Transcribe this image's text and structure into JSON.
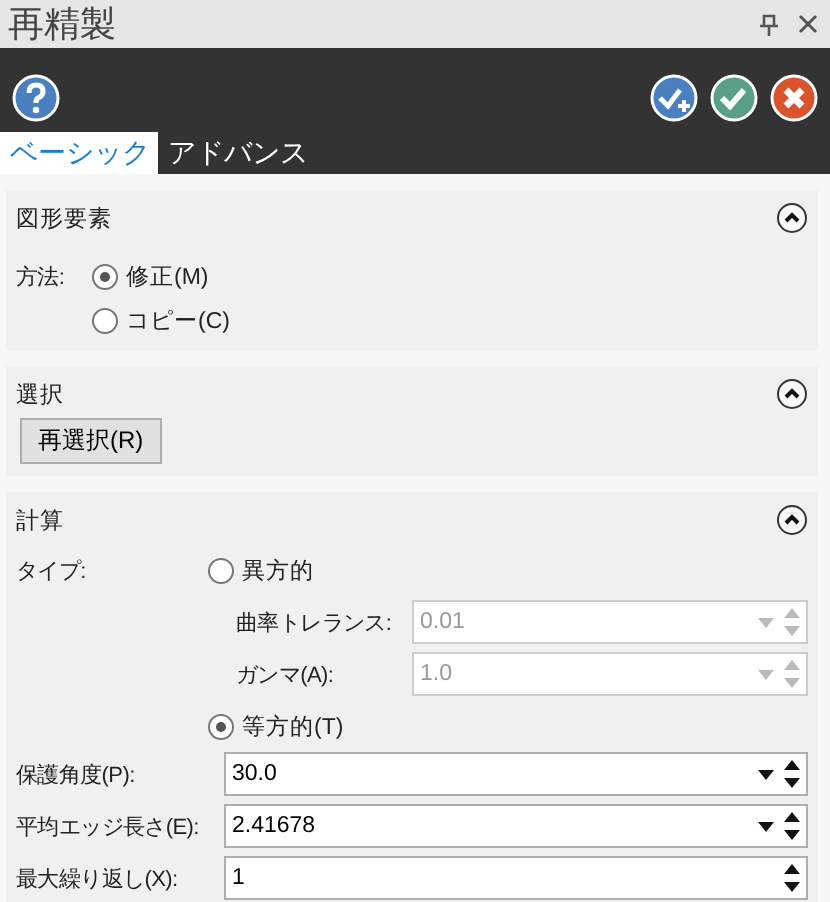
{
  "window": {
    "title": "再精製"
  },
  "tabs": [
    {
      "label": "ベーシック",
      "selected": true
    },
    {
      "label": "アドバンス",
      "selected": false
    }
  ],
  "sections": [
    {
      "kind": "radio-group",
      "title": "図形要素",
      "expanded": true,
      "label": "方法:",
      "options": [
        {
          "label": "修正(M)",
          "selected": true
        },
        {
          "label": "コピー(C)",
          "selected": false
        }
      ]
    },
    {
      "kind": "button",
      "title": "選択",
      "expanded": true,
      "button": "再選択(R)"
    },
    {
      "kind": "calculation",
      "title": "計算",
      "expanded": true,
      "type_label": "タイプ:",
      "types": [
        {
          "label": "異方的",
          "selected": false,
          "fields": [
            {
              "label": "曲率トレランス:",
              "value": "0.01",
              "disabled": true,
              "dropdown": true
            },
            {
              "label": "ガンマ(A):",
              "value": "1.0",
              "disabled": true,
              "dropdown": true
            }
          ]
        },
        {
          "label": "等方的(T)",
          "selected": true
        }
      ],
      "fields": [
        {
          "label": "保護角度(P):",
          "value": "30.0",
          "disabled": false,
          "dropdown": true
        },
        {
          "label": "平均エッジ長さ(E):",
          "value": "2.41678",
          "disabled": false,
          "dropdown": true
        },
        {
          "label": "最大繰り返し(X):",
          "value": "1",
          "disabled": false,
          "dropdown": false
        }
      ]
    }
  ]
}
